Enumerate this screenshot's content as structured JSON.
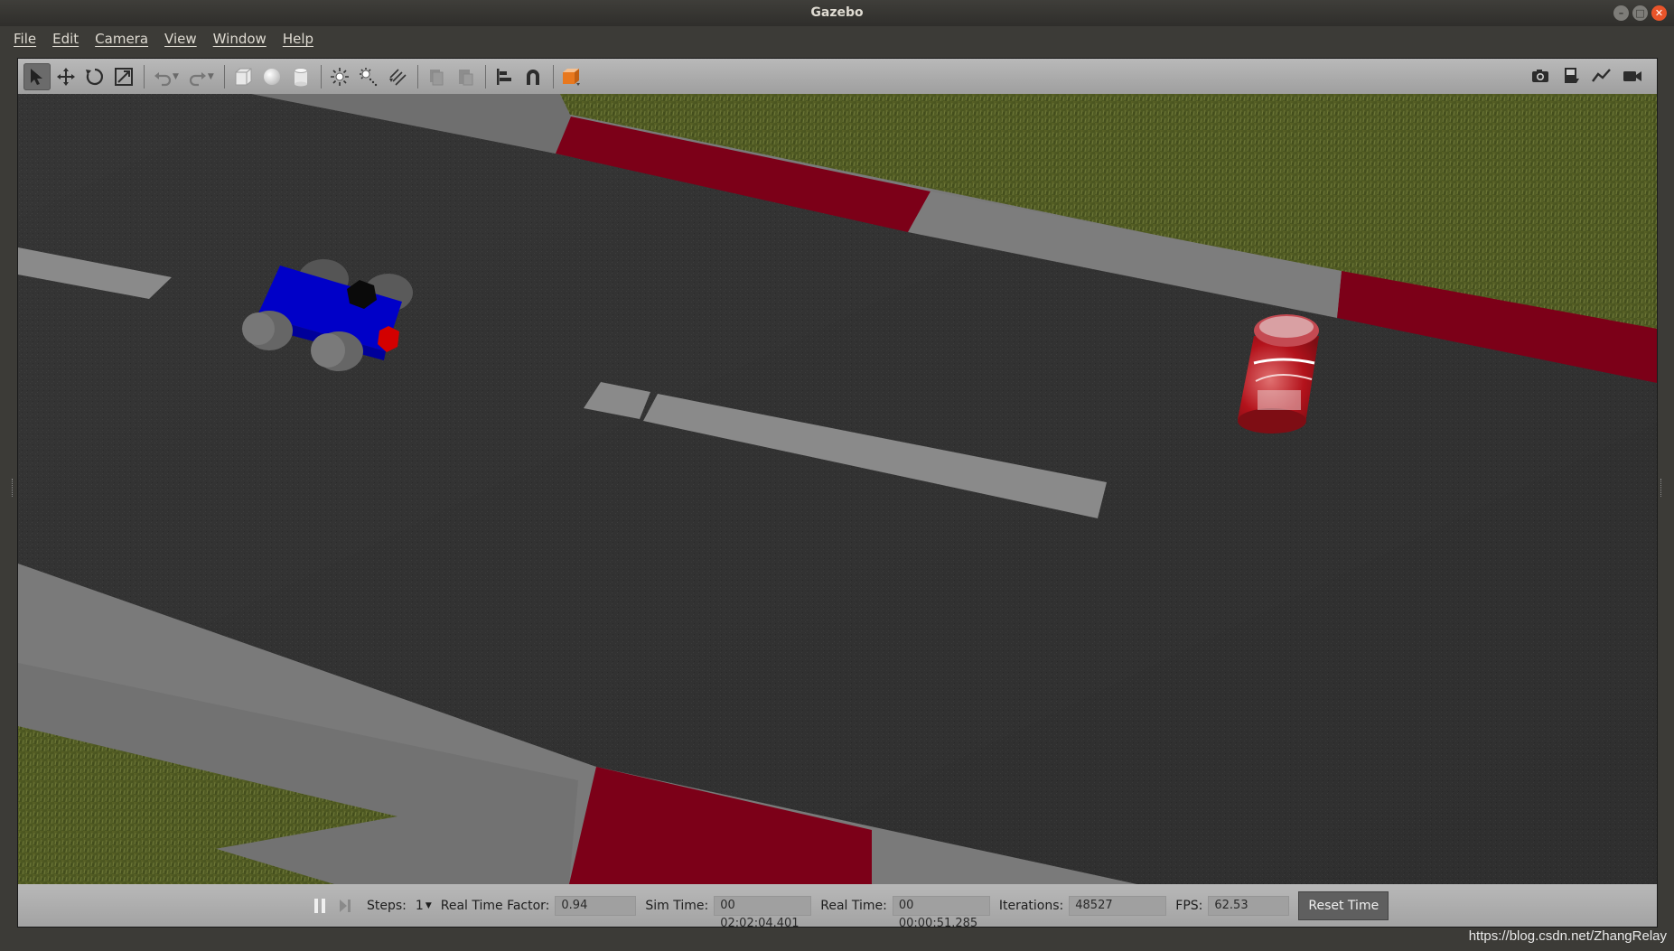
{
  "window": {
    "title": "Gazebo"
  },
  "menu": {
    "items": [
      "File",
      "Edit",
      "Camera",
      "View",
      "Window",
      "Help"
    ]
  },
  "toolbar": {
    "left_icons": [
      "select-mode-icon",
      "translate-mode-icon",
      "rotate-mode-icon",
      "scale-mode-icon",
      "undo-icon",
      "redo-icon",
      "box-shape-icon",
      "sphere-shape-icon",
      "cylinder-shape-icon",
      "point-light-icon",
      "spot-light-icon",
      "directional-light-icon",
      "copy-icon",
      "paste-icon",
      "align-icon",
      "snap-icon",
      "view-angle-icon"
    ],
    "right_icons": [
      "screenshot-icon",
      "log-data-icon",
      "plot-icon",
      "record-video-icon"
    ]
  },
  "scene": {
    "objects": [
      "blue-robot-car",
      "coke-can",
      "race-track",
      "grass"
    ],
    "colors": {
      "asphalt": "#333333",
      "grass": "#4f5a22",
      "curb_red": "#7c0018",
      "curb_gray": "#7a7a7a",
      "robot_body": "#0000c8",
      "robot_sensor": "#d30000"
    }
  },
  "status": {
    "steps_label": "Steps:",
    "steps_value": "1",
    "rtf_label": "Real Time Factor:",
    "rtf_value": "0.94",
    "sim_time_label": "Sim Time:",
    "sim_time_value": "00 02:02:04.401",
    "real_time_label": "Real Time:",
    "real_time_value": "00 00:00:51.285",
    "iterations_label": "Iterations:",
    "iterations_value": "48527",
    "fps_label": "FPS:",
    "fps_value": "62.53",
    "reset_label": "Reset Time"
  },
  "watermark": "https://blog.csdn.net/ZhangRelay"
}
